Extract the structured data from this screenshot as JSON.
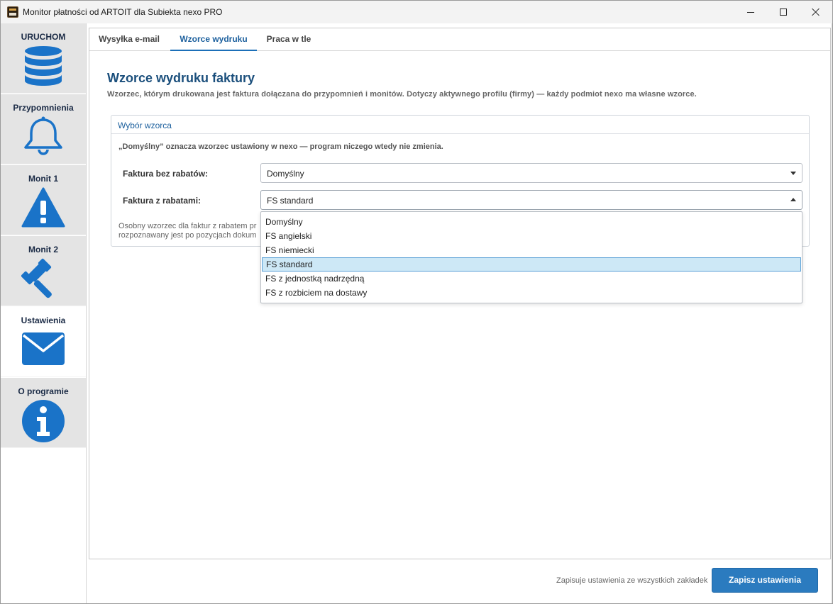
{
  "window": {
    "title": "Monitor płatności od ARTOIT dla Subiekta nexo PRO"
  },
  "sidebar": {
    "items": [
      {
        "label": "URUCHOM",
        "icon": "database-icon"
      },
      {
        "label": "Przypomnienia",
        "icon": "bell-icon"
      },
      {
        "label": "Monit 1",
        "icon": "warning-icon"
      },
      {
        "label": "Monit 2",
        "icon": "gavel-icon"
      },
      {
        "label": "Ustawienia",
        "icon": "envelope-icon"
      },
      {
        "label": "O programie",
        "icon": "info-icon"
      }
    ],
    "active_index": 4
  },
  "tabs": [
    {
      "label": "Wysyłka e-mail"
    },
    {
      "label": "Wzorce wydruku"
    },
    {
      "label": "Praca w tle"
    }
  ],
  "active_tab": "Wzorce wydruku",
  "content": {
    "title": "Wzorce wydruku faktury",
    "description": "Wzorzec, którym drukowana jest faktura dołączana do przypomnień i monitów. Dotyczy aktywnego profilu (firmy) — każdy podmiot nexo ma własne wzorce.",
    "group": {
      "title": "Wybór wzorca",
      "note": "„Domyślny” oznacza wzorzec ustawiony w nexo — program niczego wtedy nie zmienia.",
      "field1_label": "Faktura bez rabatów:",
      "field1_value": "Domyślny",
      "field2_label": "Faktura z rabatami:",
      "field2_value": "FS standard",
      "hint_line1": "Osobny wzorzec dla faktur z rabatem pr",
      "hint_line2": "rozpoznawany jest po pozycjach dokum"
    }
  },
  "dropdown": {
    "options": [
      "Domyślny",
      "FS angielski",
      "FS niemiecki",
      "FS standard",
      "FS z jednostką nadrzędną",
      "FS z rozbiciem na dostawy"
    ],
    "selected": "FS standard"
  },
  "footer": {
    "note": "Zapisuje ustawienia ze wszystkich zakładek",
    "save_label": "Zapisz ustawienia"
  },
  "colors": {
    "accent": "#2b7bbf",
    "icon_blue": "#1a73c8",
    "title_blue": "#1b4f7c",
    "selected_bg": "#cde8f6"
  }
}
